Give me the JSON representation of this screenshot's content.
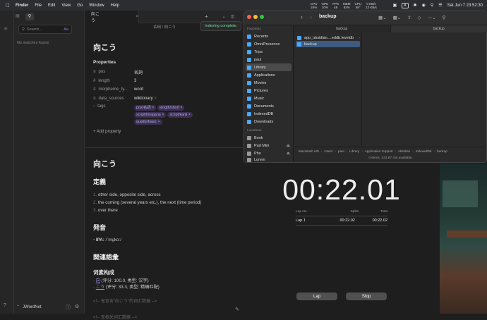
{
  "menubar": {
    "app": "Finder",
    "items": [
      "File",
      "Edit",
      "View",
      "Go",
      "Window",
      "Help"
    ],
    "stats": [
      {
        "label": "CPU",
        "value": "24%"
      },
      {
        "label": "GPU",
        "value": "10%"
      },
      {
        "label": "FPS",
        "value": "48"
      },
      {
        "label": "MEM",
        "value": "62%"
      },
      {
        "label": "CPU",
        "value": "68°"
      },
      {
        "label": "",
        "value": "0 KB/s"
      }
    ],
    "net_up": "0 KB/s",
    "net_down": "12 KB/s",
    "input_source": "A",
    "clock": "Sat Jun 7  23:52:30"
  },
  "obsidian": {
    "search": {
      "placeholder": "Search...",
      "case_toggle": "Aa",
      "no_matches": "No matches found."
    },
    "tab_title": "向こう",
    "breadcrumb": "名詞 / 向こう",
    "notice": "Indexing complete.",
    "vault_name": "JWordNet",
    "note": {
      "title": "向こう",
      "properties_heading": "Properties",
      "properties": [
        {
          "key": "pos",
          "value": "名詞"
        },
        {
          "key": "length",
          "value": "3"
        },
        {
          "key": "morpheme_ty...",
          "value": "word"
        },
        {
          "key": "data_sources",
          "value": "wiktionary"
        }
      ],
      "tags_key": "tags",
      "tags": [
        "pos/名詞",
        "length/short",
        "script/hiragana",
        "script/kanji",
        "quality/basic"
      ],
      "add_property": "+ Add property",
      "h1": "向こう",
      "def_heading": "定義",
      "definitions": [
        "other side, opposite side, across",
        "the coming (several years etc.), the next (time period)",
        "over there"
      ],
      "pron_heading": "発音",
      "ipa_label": "IPA:",
      "ipa_value": "/ˈmu̥koː/",
      "related_heading": "関連語彙",
      "composition_heading": "词素构成",
      "composition": [
        {
          "link": "向",
          "rest": " (评分: 100.0, 类型: 汉字)"
        },
        {
          "link": "こう",
          "rest": " (评分: 33.3, 类型: 精确匹配)"
        }
      ],
      "comment1": "<!-- 无包含\"向こう\"的词汇数据 -->",
      "comment2": "<!-- 无相关词汇数据 -->"
    }
  },
  "finder": {
    "title": "backup",
    "tabs": [
      "backup",
      "backup"
    ],
    "sidebar_heading_fav": "Favorites",
    "favorites": [
      "Recents",
      "OmniPresence",
      "Trips",
      "paul",
      "Library",
      "Applications",
      "Movies",
      "Pictures",
      "Music",
      "Documents",
      "IndexedDB",
      "Downloads"
    ],
    "selected_favorite": "Library",
    "sidebar_heading_loc": "Locations",
    "locations": [
      "Book",
      "Pad Mini",
      "Pho",
      "Lorem"
    ],
    "files": [
      "app_obsidian....eddb.leveldb",
      "backup"
    ],
    "path": [
      "Macintosh HD",
      "Users",
      "paul",
      "Library",
      "Application Support",
      "obsidian",
      "IndexedDB",
      "backup"
    ],
    "status": "0 items, 433.97 GB available"
  },
  "stopwatch": {
    "time": "00:22.01",
    "headers": [
      "Lap No.",
      "Splits",
      "Total"
    ],
    "laps": [
      {
        "lap": "Lap 1",
        "split": "00:22.02",
        "total": "00:22.02"
      }
    ],
    "lap_button": "Lap",
    "stop_button": "Stop"
  }
}
